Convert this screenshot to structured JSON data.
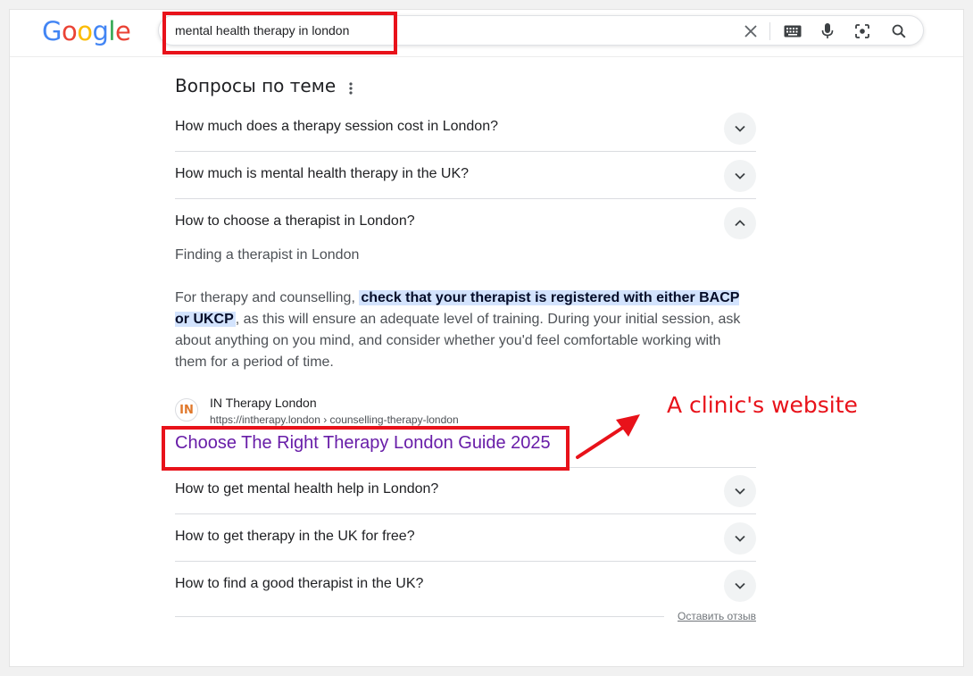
{
  "brand": {
    "logo_letters": [
      "G",
      "o",
      "o",
      "g",
      "l",
      "e"
    ],
    "logo_colors": [
      "#4285F4",
      "#EA4335",
      "#FBBC05",
      "#4285F4",
      "#34A853",
      "#EA4335"
    ]
  },
  "search": {
    "query": "mental health therapy in london",
    "icons": [
      "close-icon",
      "keyboard-icon",
      "microphone-icon",
      "lens-icon",
      "search-icon"
    ]
  },
  "related_questions": {
    "title": "Вопросы по теме",
    "items": [
      {
        "question": "How much does a therapy session cost in London?",
        "expanded": false
      },
      {
        "question": "How much is mental health therapy in the UK?",
        "expanded": false
      },
      {
        "question": "How to choose a therapist in London?",
        "expanded": true
      },
      {
        "question": "How to get mental health help in London?",
        "expanded": false
      },
      {
        "question": "How to get therapy in the UK for free?",
        "expanded": false
      },
      {
        "question": "How to find a good therapist in the UK?",
        "expanded": false
      }
    ],
    "answer": {
      "heading": "Finding a therapist in London",
      "text_before": "For therapy and counselling, ",
      "text_highlight": "check that your therapist is registered with either BACP or UKCP",
      "text_after": ", as this will ensure an adequate level of training. During your initial session, ask about anything on you mind, and consider whether you'd feel comfortable working with them for a period of time.",
      "source": {
        "favicon_text": "IN",
        "name": "IN Therapy London",
        "url": "https://intherapy.london › counselling-therapy-london",
        "link_title": "Choose The Right Therapy London Guide 2025"
      }
    },
    "feedback_label": "Оставить отзыв"
  },
  "annotation": {
    "label": "A clinic's website",
    "color": "#e8121a"
  }
}
